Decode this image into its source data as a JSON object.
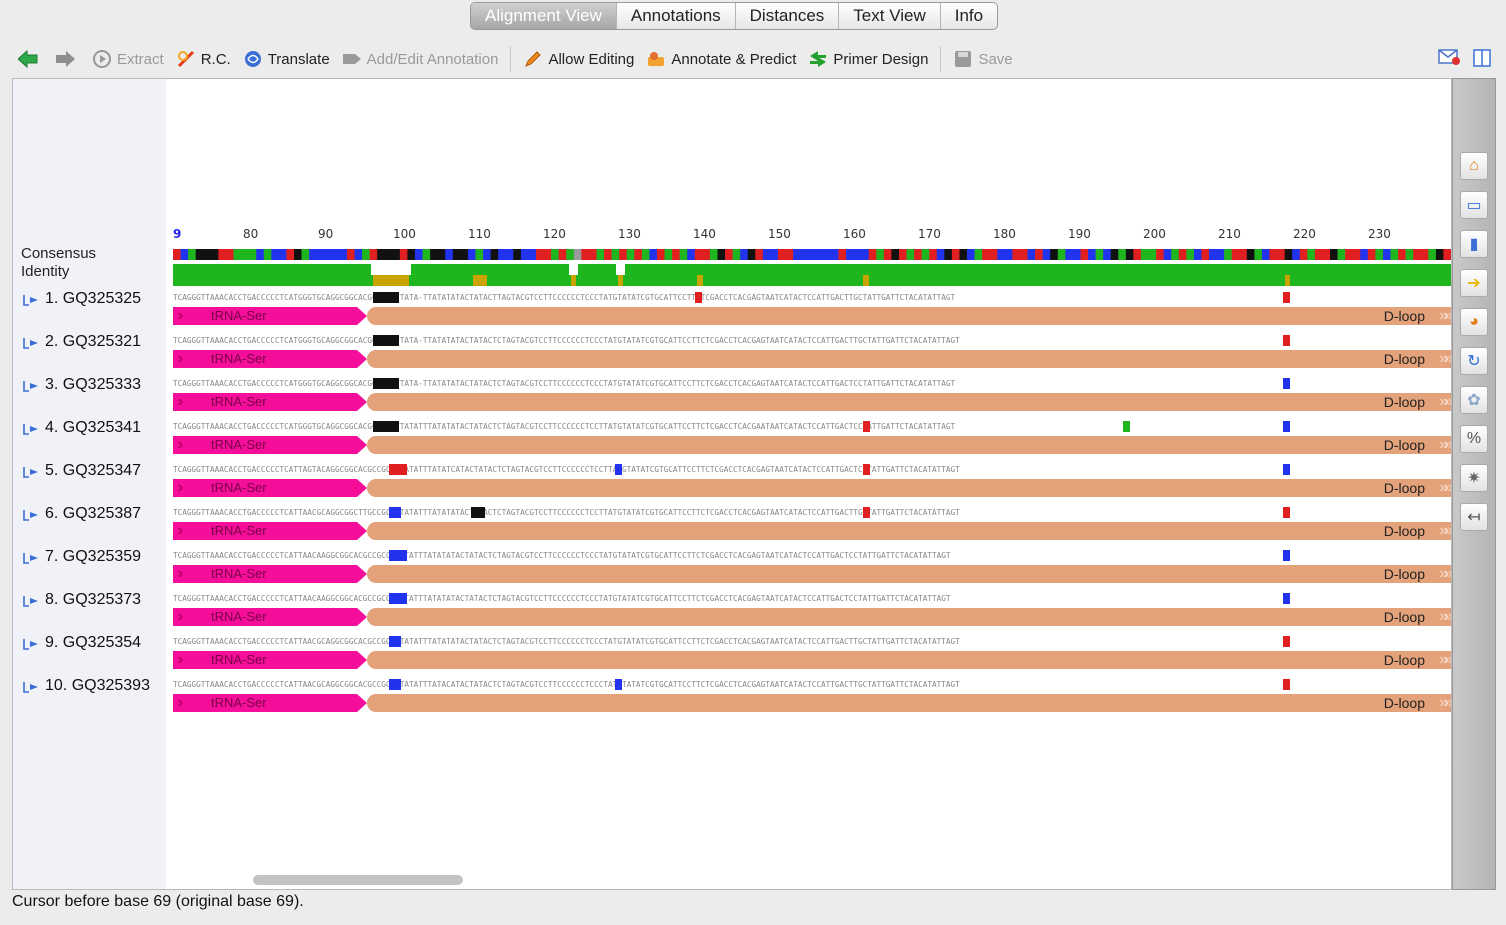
{
  "tabs": [
    {
      "label": "Alignment View",
      "active": true
    },
    {
      "label": "Annotations",
      "active": false
    },
    {
      "label": "Distances",
      "active": false
    },
    {
      "label": "Text View",
      "active": false
    },
    {
      "label": "Info",
      "active": false
    }
  ],
  "toolbar": {
    "back_icon": "back-arrow-icon",
    "forward_icon": "forward-arrow-icon",
    "extract_label": "Extract",
    "rc_label": "R.C.",
    "translate_label": "Translate",
    "add_annotation_label": "Add/Edit Annotation",
    "allow_editing_label": "Allow Editing",
    "annotate_predict_label": "Annotate & Predict",
    "primer_design_label": "Primer Design",
    "save_label": "Save"
  },
  "consensus": {
    "line1": "Consensus",
    "line2": "Identity"
  },
  "ruler_ticks": [
    "9",
    "80",
    "90",
    "100",
    "110",
    "120",
    "130",
    "140",
    "150",
    "160",
    "170",
    "180",
    "190",
    "200",
    "210",
    "220",
    "230"
  ],
  "sequences": [
    {
      "name": "1. GQ325325",
      "seq": "TCAGGGTTAAACACCTGACCCCCTCATGGGTGCAGGCGGCACGCCGCCTTATA-TTATATATACTATACTTAGTACGTCCTTCCCCCCTCCCTATGTATATCGTGCATTCCTTCTCGACCTCACGAGTAATCATACTCCATTGACTTGCTATTGATTCTACATATTAGT",
      "trna": "tRNA-Ser",
      "dloop": "D-loop"
    },
    {
      "name": "2. GQ325321",
      "seq": "TCAGGGTTAAACACCTGACCCCCTCATGGGTGCAGGCGGCACGCCGCCTTATA-TTATATATACTATACTCTAGTACGTCCTTCCCCCCTCCCTATGTATATCGTGCATTCCTTCTCGACCTCACGAGTAATCATACTCCATTGACTTGCTATTGATTCTACATATTAGT",
      "trna": "tRNA-Ser",
      "dloop": "D-loop"
    },
    {
      "name": "3. GQ325333",
      "seq": "TCAGGGTTAAACACCTGACCCCCTCATGGGTGCAGGCGGCACGCCGCCTTATA-TTATATATACTATACTCTAGTACGTCCTTCCCCCCTCCCTATGTATATCGTGCATTCCTTCTCGACCTCACGAGTAATCATACTCCATTGACTCCTATTGATTCTACATATTAGT",
      "trna": "tRNA-Ser",
      "dloop": "D-loop"
    },
    {
      "name": "4. GQ325341",
      "seq": "TCAGGGTTAAACACCTGACCCCCTCATGGGTGCAGGCGGCACGCCGCCTTATATTTATATATACTATACTCTAGTACGTCCTTCCCCCCTCCTTATGTATATCGTGCATTCCTTCTCGACCTCACGAATAATCATACTCCATTGACTCCTATTGATTCTACATATTAGT",
      "trna": "tRNA-Ser",
      "dloop": "D-loop"
    },
    {
      "name": "5. GQ325347",
      "seq": "TCAGGGTTAAACACCTGACCCCCTCATTAGTACAGGCGGCACGCCGCCTTATATTTATATCATACTATACTCTAGTACGTCCTTCCCCCCTCCTTATGTATATCGTGCATTCCTTCTCGACCTCACGAGTAATCATACTCCATTGACTCCTATTGATTCTACATATTAGT",
      "trna": "tRNA-Ser",
      "dloop": "D-loop"
    },
    {
      "name": "6. GQ325387",
      "seq": "TCAGGGTTAAACACCTGACCCCCTCATTAACGCAGGCGGCTTGCCGCCTTATATTTATATATACTATACTCTAGTACGTCCTTCCCCCCTCCTTATGTATATCGTGCATTCCTTCTCGACCTCACGAGTAATCATACTCCATTGACTTGCTATTGATTCTACATATTAGT",
      "trna": "tRNA-Ser",
      "dloop": "D-loop"
    },
    {
      "name": "7. GQ325359",
      "seq": "TCAGGGTTAAACACCTGACCCCCTCATTAACAAGGCGGCACGCCGCCTTATATTTATATATACTATACTCTAGTACGTCCTTCCCCCCTCCCTATGTATATCGTGCATTCCTTCTCGACCTCACGAGTAATCATACTCCATTGACTCCTATTGATTCTACATATTAGT",
      "trna": "tRNA-Ser",
      "dloop": "D-loop"
    },
    {
      "name": "8. GQ325373",
      "seq": "TCAGGGTTAAACACCTGACCCCCTCATTAACAAGGCGGCACGCCGCCTTATATTTATATATACTATACTCTAGTACGTCCTTCCCCCCTCCCTATGTATATCGTGCATTCCTTCTCGACCTCACGAGTAATCATACTCCATTGACTCCTATTGATTCTACATATTAGT",
      "trna": "tRNA-Ser",
      "dloop": "D-loop"
    },
    {
      "name": "9. GQ325354",
      "seq": "TCAGGGTTAAACACCTGACCCCCTCATTAACGCAGGCGGCACGCCGCCTTATATTTATATATACTATACTCTAGTACGTCCTTCCCCCCTCCCTATGTATATCGTGCATTCCTTCTCGACCTCACGAGTAATCATACTCCATTGACTTGCTATTGATTCTACATATTAGT",
      "trna": "tRNA-Ser",
      "dloop": "D-loop"
    },
    {
      "name": "10. GQ325393",
      "seq": "TCAGGGTTAAACACCTGACCCCCTCATTAACGCAGGCGGCACGCCGCCTTATATTTATACATACTATACTCTAGTACGTCCTTCCCCCCTCCCTATGTATATCGTGCATTCCTTCTCGACCTCACGAGTAATCATACTCCATTGACTTGCTATTGATTCTACATATTAGT",
      "trna": "tRNA-Ser",
      "dloop": "D-loop"
    }
  ],
  "side_panel_icons": [
    "home-icon",
    "monitor-icon",
    "bar-chart-icon",
    "arrow-right-icon",
    "pie-icon",
    "refresh-icon",
    "gear-circle-icon",
    "percent-icon",
    "settings-icon",
    "collapse-icon"
  ],
  "side_panel_glyphs": [
    "⌂",
    "▭",
    "▮",
    "➔",
    "◕",
    "↻",
    "✿",
    "%",
    "✷",
    "↤"
  ],
  "status": "Cursor before base 69 (original base 69).",
  "colors": {
    "accent_green": "#1fb51f",
    "trna_pink": "#f40e9a",
    "dloop_tan": "#e3a27a",
    "identity_low": "#c9a400"
  }
}
